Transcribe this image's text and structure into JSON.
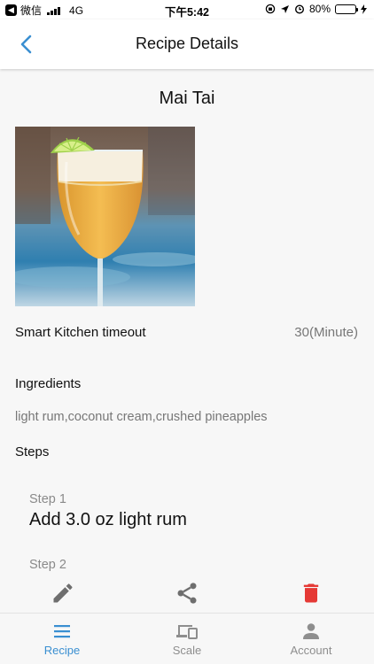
{
  "status_bar": {
    "carrier": "微信",
    "network": "4G",
    "time": "下午5:42",
    "battery_percent": "80%"
  },
  "nav": {
    "title": "Recipe Details",
    "back_icon": "chevron-left-icon"
  },
  "recipe": {
    "name": "Mai Tai",
    "image_icon": "cocktail-photo",
    "timeout_label": "Smart Kitchen timeout",
    "timeout_value": "30(Minute)",
    "ingredients_label": "Ingredients",
    "ingredients": "light rum,coconut cream,crushed pineapples",
    "steps_label": "Steps",
    "steps": [
      {
        "number": "Step 1",
        "text": "Add 3.0 oz light rum"
      },
      {
        "number": "Step 2",
        "text": ""
      }
    ]
  },
  "actions": [
    {
      "name": "edit",
      "icon": "pencil-icon",
      "color": "#6e6e6e"
    },
    {
      "name": "share",
      "icon": "share-icon",
      "color": "#6e6e6e"
    },
    {
      "name": "delete",
      "icon": "trash-icon",
      "color": "#e53935"
    }
  ],
  "tabs": [
    {
      "label": "Recipe",
      "icon": "menu-icon",
      "active": true
    },
    {
      "label": "Scale",
      "icon": "devices-icon",
      "active": false
    },
    {
      "label": "Account",
      "icon": "person-icon",
      "active": false
    }
  ],
  "colors": {
    "accent": "#3a8fd1",
    "delete": "#e53935",
    "background": "#f7f7f7"
  }
}
